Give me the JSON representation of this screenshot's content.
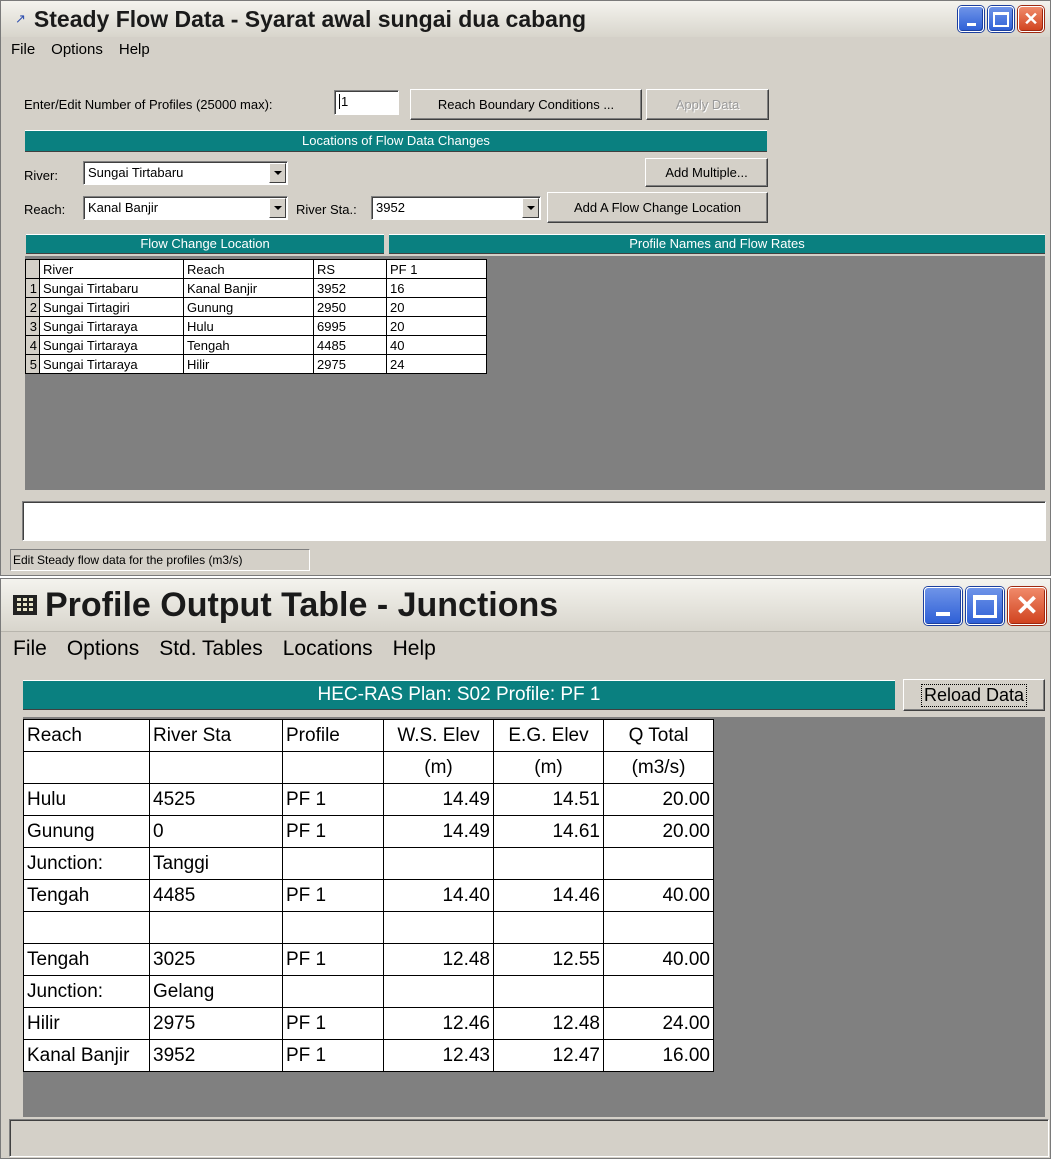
{
  "steady": {
    "title": "Steady Flow Data - Syarat awal sungai dua cabang",
    "menu": [
      "File",
      "Options",
      "Help"
    ],
    "profiles_label": "Enter/Edit Number of Profiles (25000 max):",
    "profiles_value": "1",
    "reach_bc_button": "Reach Boundary Conditions ...",
    "apply_button": "Apply Data",
    "locations_header": "Locations of Flow Data Changes",
    "river_label": "River:",
    "river_value": "Sungai Tirtabaru",
    "add_multiple_button": "Add Multiple...",
    "reach_label": "Reach:",
    "reach_value": "Kanal Banjir",
    "river_sta_label": "River Sta.:",
    "river_sta_value": "3952",
    "add_flow_change_button": "Add A Flow Change Location",
    "flow_change_header": "Flow Change Location",
    "profile_names_header": "Profile Names and Flow Rates",
    "table_headers": [
      "River",
      "Reach",
      "RS",
      "PF 1"
    ],
    "rows": [
      {
        "n": "1",
        "river": "Sungai Tirtabaru",
        "reach": "Kanal Banjir",
        "rs": "3952",
        "pf1": "16"
      },
      {
        "n": "2",
        "river": "Sungai Tirtagiri",
        "reach": "Gunung",
        "rs": "2950",
        "pf1": "20"
      },
      {
        "n": "3",
        "river": "Sungai Tirtaraya",
        "reach": "Hulu",
        "rs": "6995",
        "pf1": "20"
      },
      {
        "n": "4",
        "river": "Sungai Tirtaraya",
        "reach": "Tengah",
        "rs": "4485",
        "pf1": "40"
      },
      {
        "n": "5",
        "river": "Sungai Tirtaraya",
        "reach": "Hilir",
        "rs": "2975",
        "pf1": "24"
      }
    ],
    "status": "Edit Steady flow data for the profiles (m3/s)"
  },
  "profile": {
    "title": "Profile Output Table - Junctions",
    "menu": [
      "File",
      "Options",
      "Std. Tables",
      "Locations",
      "Help"
    ],
    "plan_header": "HEC-RAS  Plan: S02    Profile: PF 1",
    "reload_button": "Reload Data",
    "headers": [
      "Reach",
      "River Sta",
      "Profile",
      "W.S. Elev",
      "E.G. Elev",
      "Q Total"
    ],
    "units": [
      "",
      "",
      "",
      "(m)",
      "(m)",
      "(m3/s)"
    ],
    "rows": [
      [
        "Hulu",
        "4525",
        "PF 1",
        "14.49",
        "14.51",
        "20.00"
      ],
      [
        "Gunung",
        "0",
        "PF 1",
        "14.49",
        "14.61",
        "20.00"
      ],
      [
        "Junction:",
        "Tanggi",
        "",
        "",
        "",
        ""
      ],
      [
        "Tengah",
        "4485",
        "PF 1",
        "14.40",
        "14.46",
        "40.00"
      ],
      [
        "",
        "",
        "",
        "",
        "",
        ""
      ],
      [
        "Tengah",
        "3025",
        "PF 1",
        "12.48",
        "12.55",
        "40.00"
      ],
      [
        "Junction:",
        "Gelang",
        "",
        "",
        "",
        ""
      ],
      [
        "Hilir",
        "2975",
        "PF 1",
        "12.46",
        "12.48",
        "24.00"
      ],
      [
        "Kanal Banjir",
        "3952",
        "PF 1",
        "12.43",
        "12.47",
        "16.00"
      ]
    ]
  },
  "colors": {
    "teal": "#0a8080",
    "face": "#d4d0c8",
    "grid_bg": "#808080"
  }
}
